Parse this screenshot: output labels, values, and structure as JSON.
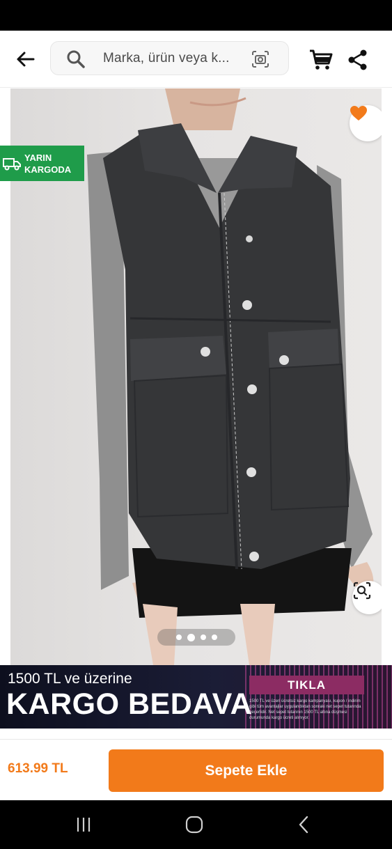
{
  "header": {
    "search_placeholder": "Marka, ürün veya k..."
  },
  "product": {
    "badge_line1": "YARIN",
    "badge_line2": "KARGODA",
    "image_count": 4,
    "active_image_index": 1,
    "price": "613.99 TL",
    "add_to_cart_label": "Sepete Ekle"
  },
  "promo": {
    "line1": "1500 TL ve üzerine",
    "line2": "KARGO BEDAVA",
    "cta": "TIKLA",
    "fine_print": "1500 TL ve üzeri ücretsiz kargo kampanyası, kupon / indirim gibi tüm avantajlar uygulandıktan sonraki net sepet tutarında geçerlidir. Net sepet tutarının 1500 TL altına düşmesi durumunda kargo ücreti alınıyor."
  },
  "colors": {
    "brand_orange": "#f27a1a",
    "cargo_green": "#1f9c4a",
    "promo_cta": "#8c2c63"
  },
  "icons": [
    "back-arrow-icon",
    "search-icon",
    "camera-search-icon",
    "cart-icon",
    "share-icon",
    "truck-icon",
    "heart-icon",
    "visual-search-icon",
    "recents-icon",
    "home-icon",
    "back-nav-icon"
  ]
}
